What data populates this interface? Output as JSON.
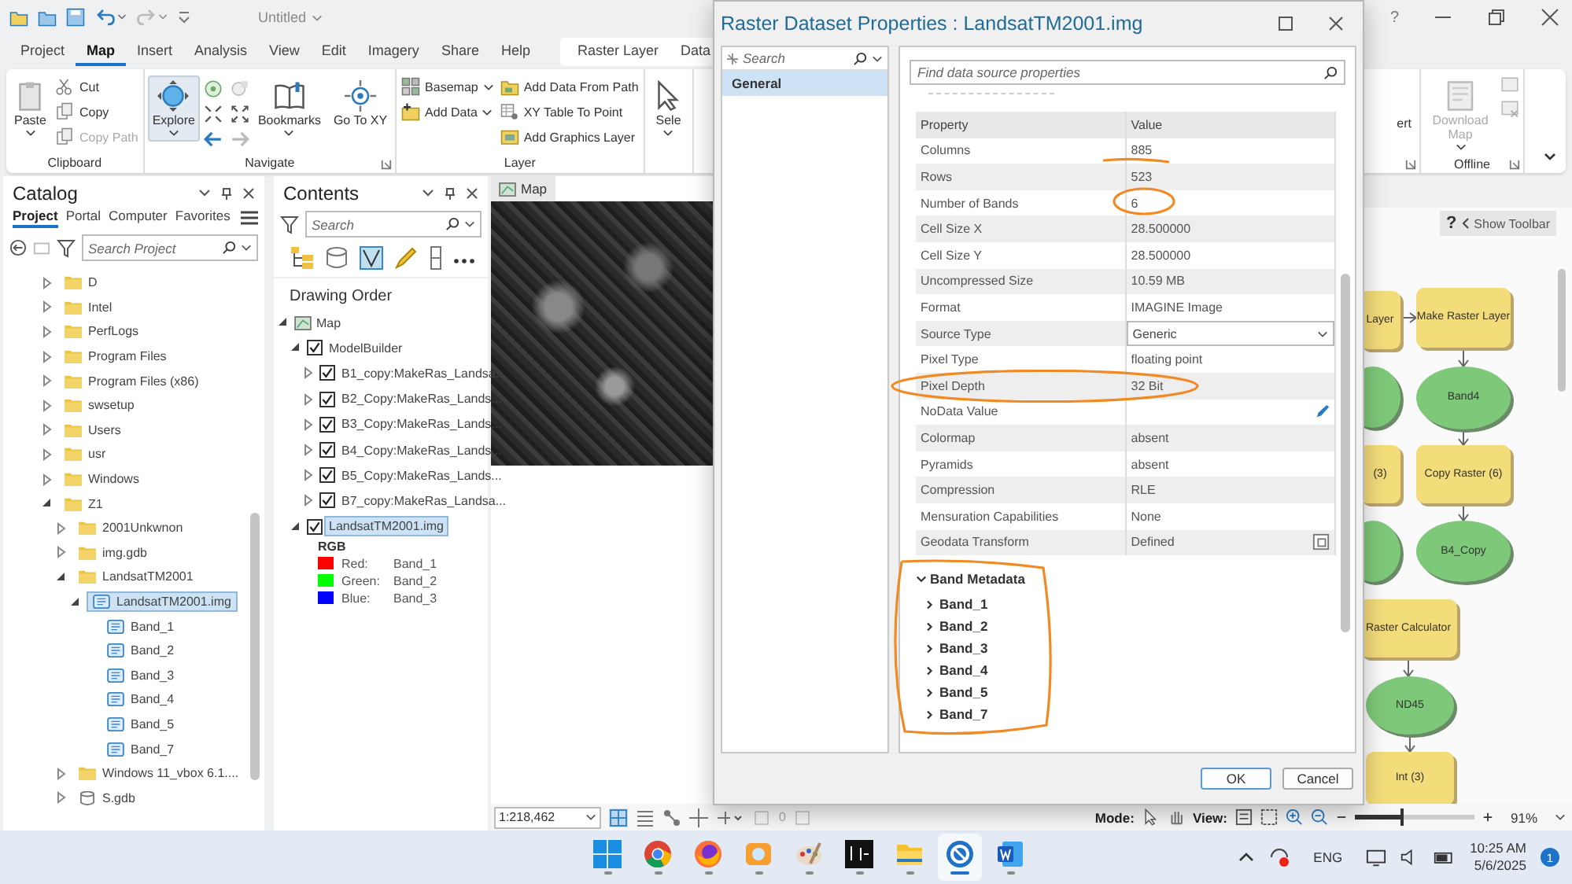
{
  "titlebar": {
    "title": "Untitled",
    "help": "?"
  },
  "ribbon": {
    "tabs": [
      {
        "label": "Project",
        "selected": false
      },
      {
        "label": "Map",
        "selected": true
      },
      {
        "label": "Insert",
        "selected": false
      },
      {
        "label": "Analysis",
        "selected": false
      },
      {
        "label": "View",
        "selected": false
      },
      {
        "label": "Edit",
        "selected": false
      },
      {
        "label": "Imagery",
        "selected": false
      },
      {
        "label": "Share",
        "selected": false
      },
      {
        "label": "Help",
        "selected": false
      }
    ],
    "contextual_tabs": [
      {
        "label": "Raster Layer",
        "selected": false
      },
      {
        "label": "Data",
        "selected": false
      }
    ],
    "groups": [
      {
        "label": "Clipboard",
        "columns": [
          [
            {
              "kind": "large",
              "label": "Paste",
              "caret": true,
              "disabled": false,
              "active": false
            }
          ],
          [
            {
              "kind": "small",
              "label": "Cut",
              "disabled": false,
              "active": false
            },
            {
              "kind": "small",
              "label": "Copy",
              "disabled": false,
              "active": false
            },
            {
              "kind": "small",
              "label": "Copy Path",
              "disabled": true,
              "active": false
            }
          ]
        ]
      },
      {
        "label": "Navigate",
        "launcher": true,
        "columns": [
          [
            {
              "kind": "large",
              "label": "Explore",
              "caret": true,
              "disabled": false,
              "active": true
            }
          ],
          [
            {
              "kind": "nav"
            }
          ],
          [
            {
              "kind": "large",
              "label": "Bookmarks",
              "caret": true,
              "disabled": false,
              "active": false
            }
          ],
          [
            {
              "kind": "large",
              "label": "Go To XY",
              "disabled": false,
              "active": false
            }
          ]
        ]
      },
      {
        "label": "Layer",
        "columns": [
          [
            {
              "kind": "small",
              "label": "Basemap",
              "caret": true,
              "disabled": false,
              "active": false
            },
            {
              "kind": "small",
              "label": "Add Data",
              "caret": true,
              "disabled": false,
              "active": false
            }
          ],
          [
            {
              "kind": "small",
              "label": "Add Data From Path",
              "disabled": false,
              "active": false
            },
            {
              "kind": "small",
              "label": "XY Table To Point",
              "disabled": false,
              "active": false
            },
            {
              "kind": "small",
              "label": "Add Graphics Layer",
              "disabled": false,
              "active": false
            }
          ]
        ]
      },
      {
        "columns": [
          [
            {
              "kind": "large",
              "label": "Sele",
              "caret": true,
              "disabled": false,
              "active": false
            }
          ]
        ]
      }
    ],
    "groups_right": [
      {
        "launcher": true,
        "columns": [
          [
            {
              "kind": "large",
              "label": "ert",
              "disabled": false,
              "active": false
            }
          ]
        ]
      },
      {
        "label": "Offline",
        "launcher": true,
        "columns": [
          [
            {
              "kind": "large",
              "label": "Download Map",
              "caret": true,
              "disabled": true,
              "active": false
            }
          ],
          [
            {
              "kind": "minis"
            }
          ]
        ]
      }
    ]
  },
  "catalog": {
    "title": "Catalog",
    "tabs": [
      {
        "label": "Project",
        "selected": true
      },
      {
        "label": "Portal",
        "selected": false
      },
      {
        "label": "Computer",
        "selected": false
      },
      {
        "label": "Favorites",
        "selected": false
      }
    ],
    "search_placeholder": "Search Project",
    "tree": [
      {
        "label": "D",
        "kind": "folder",
        "expanded": false,
        "selected": false
      },
      {
        "label": "Intel",
        "kind": "folder",
        "expanded": false,
        "selected": false
      },
      {
        "label": "PerfLogs",
        "kind": "folder",
        "expanded": false,
        "selected": false
      },
      {
        "label": "Program Files",
        "kind": "folder",
        "expanded": false,
        "selected": false
      },
      {
        "label": "Program Files (x86)",
        "kind": "folder",
        "expanded": false,
        "selected": false
      },
      {
        "label": "swsetup",
        "kind": "folder",
        "expanded": false,
        "selected": false
      },
      {
        "label": "Users",
        "kind": "folder",
        "expanded": false,
        "selected": false
      },
      {
        "label": "usr",
        "kind": "folder",
        "expanded": false,
        "selected": false
      },
      {
        "label": "Windows",
        "kind": "folder",
        "expanded": false,
        "selected": false
      },
      {
        "label": "Z1",
        "kind": "folder",
        "expanded": true,
        "selected": false,
        "children": [
          {
            "label": "2001Unkwnon",
            "kind": "folder",
            "expanded": false,
            "selected": false
          },
          {
            "label": "img.gdb",
            "kind": "folder",
            "expanded": false,
            "selected": false
          },
          {
            "label": "LandsatTM2001",
            "kind": "folder",
            "expanded": true,
            "selected": false,
            "children": [
              {
                "label": "LandsatTM2001.img",
                "kind": "raster",
                "expanded": true,
                "selected": true,
                "children": [
                  {
                    "label": "Band_1",
                    "kind": "band",
                    "selected": false
                  },
                  {
                    "label": "Band_2",
                    "kind": "band",
                    "selected": false
                  },
                  {
                    "label": "Band_3",
                    "kind": "band",
                    "selected": false
                  },
                  {
                    "label": "Band_4",
                    "kind": "band",
                    "selected": false
                  },
                  {
                    "label": "Band_5",
                    "kind": "band",
                    "selected": false
                  },
                  {
                    "label": "Band_7",
                    "kind": "band",
                    "selected": false
                  }
                ]
              }
            ]
          },
          {
            "label": "Windows 11_vbox 6.1....",
            "kind": "folder",
            "expanded": false,
            "selected": false
          },
          {
            "label": "S.gdb",
            "kind": "gdb",
            "expanded": false,
            "selected": false
          }
        ]
      }
    ]
  },
  "contents": {
    "title": "Contents",
    "search_placeholder": "Search",
    "section": "Drawing Order",
    "tree": [
      {
        "label": "Map",
        "kind": "map",
        "expanded": true,
        "selected": false,
        "children": [
          {
            "label": "ModelBuilder",
            "checked": true,
            "expanded": true,
            "selected": false,
            "children": [
              {
                "label": "B1_copy:MakeRas_Landsa...",
                "checked": true,
                "expanded": false,
                "selected": false
              },
              {
                "label": "B2_Copy:MakeRas_Lands...",
                "checked": true,
                "expanded": false,
                "selected": false
              },
              {
                "label": "B3_Copy:MakeRas_Lands...",
                "checked": true,
                "expanded": false,
                "selected": false
              },
              {
                "label": "B4_Copy:MakeRas_Lands...",
                "checked": true,
                "expanded": false,
                "selected": false
              },
              {
                "label": "B5_Copy:MakeRas_Lands...",
                "checked": true,
                "expanded": false,
                "selected": false
              },
              {
                "label": "B7_copy:MakeRas_Landsa...",
                "checked": true,
                "expanded": false,
                "selected": false
              }
            ]
          },
          {
            "label": "LandsatTM2001.img",
            "checked": true,
            "expanded": true,
            "selected": true,
            "legend": {
              "title": "RGB",
              "entries": [
                {
                  "label": "Red:",
                  "value": "Band_1",
                  "color": "#ff0000"
                },
                {
                  "label": "Green:",
                  "value": "Band_2",
                  "color": "#00ff00"
                },
                {
                  "label": "Blue:",
                  "value": "Band_3",
                  "color": "#0000ff"
                }
              ]
            }
          }
        ]
      }
    ]
  },
  "map_view": {
    "tab": "Map"
  },
  "model": {
    "help": "?",
    "toolbar": "Show Toolbar",
    "nodes": [
      {
        "kind": "tool",
        "label": "Layer"
      },
      {
        "kind": "tool",
        "label": "Make Raster Layer"
      },
      {
        "kind": "data"
      },
      {
        "kind": "data",
        "label": "Band4"
      },
      {
        "kind": "tool",
        "label": "(3)"
      },
      {
        "kind": "tool",
        "label": "Copy Raster (6)"
      },
      {
        "kind": "data"
      },
      {
        "kind": "data",
        "label": "B4_Copy"
      },
      {
        "kind": "tool",
        "label": "Raster Calculator"
      },
      {
        "kind": "data",
        "label": "ND45"
      },
      {
        "kind": "tool",
        "label": "Int (3)"
      }
    ]
  },
  "dialog": {
    "title": "Raster Dataset Properties : LandsatTM2001.img",
    "nav_search_placeholder": "Search",
    "nav": [
      {
        "label": "General",
        "selected": true
      }
    ],
    "find_placeholder": "Find data source properties",
    "table": {
      "columns": [
        "Property",
        "Value"
      ],
      "rows": [
        {
          "property": "Columns",
          "value": "885",
          "kind": "text"
        },
        {
          "property": "Rows",
          "value": "523",
          "kind": "text"
        },
        {
          "property": "Number of Bands",
          "value": "6",
          "kind": "text"
        },
        {
          "property": "Cell Size X",
          "value": "28.500000",
          "kind": "text"
        },
        {
          "property": "Cell Size Y",
          "value": "28.500000",
          "kind": "text"
        },
        {
          "property": "Uncompressed Size",
          "value": "10.59 MB",
          "kind": "text"
        },
        {
          "property": "Format",
          "value": "IMAGINE Image",
          "kind": "text"
        },
        {
          "property": "Source Type",
          "value": "Generic",
          "kind": "dropdown"
        },
        {
          "property": "Pixel Type",
          "value": "floating point",
          "kind": "text"
        },
        {
          "property": "Pixel Depth",
          "value": "32 Bit",
          "kind": "text"
        },
        {
          "property": "NoData Value",
          "kind": "editable"
        },
        {
          "property": "Colormap",
          "value": "absent",
          "kind": "text"
        },
        {
          "property": "Pyramids",
          "value": "absent",
          "kind": "text"
        },
        {
          "property": "Compression",
          "value": "RLE",
          "kind": "text"
        },
        {
          "property": "Mensuration Capabilities",
          "value": "None",
          "kind": "text"
        },
        {
          "property": "Geodata Transform",
          "value": "Defined",
          "kind": "button"
        }
      ]
    },
    "band_metadata": {
      "label": "Band Metadata",
      "expanded": true,
      "bands": [
        {
          "label": "Band_1",
          "expanded": false
        },
        {
          "label": "Band_2",
          "expanded": false
        },
        {
          "label": "Band_3",
          "expanded": false
        },
        {
          "label": "Band_4",
          "expanded": false
        },
        {
          "label": "Band_5",
          "expanded": false
        },
        {
          "label": "Band_7",
          "expanded": false
        }
      ]
    },
    "buttons": [
      {
        "label": "OK",
        "kind": "primary"
      },
      {
        "label": "Cancel",
        "kind": "secondary"
      }
    ]
  },
  "status_bar": {
    "scale": "1:218,462",
    "selection_count": "0",
    "mode_label": "Mode:",
    "view_label": "View:",
    "zoom": {
      "level": 0.4,
      "reading": "91%"
    }
  },
  "taskbar": {
    "apps": [
      {
        "kind": "start",
        "active": false
      },
      {
        "kind": "chrome",
        "active": false
      },
      {
        "kind": "firefox",
        "active": false
      },
      {
        "kind": "photos",
        "active": false
      },
      {
        "kind": "paint",
        "active": false
      },
      {
        "kind": "tile",
        "active": false
      },
      {
        "kind": "files",
        "active": false
      },
      {
        "kind": "globe",
        "active": true
      },
      {
        "kind": "word",
        "active": false
      }
    ],
    "language": "ENG",
    "time": "10:25 AM",
    "date": "5/6/2025",
    "notifications": "1"
  }
}
